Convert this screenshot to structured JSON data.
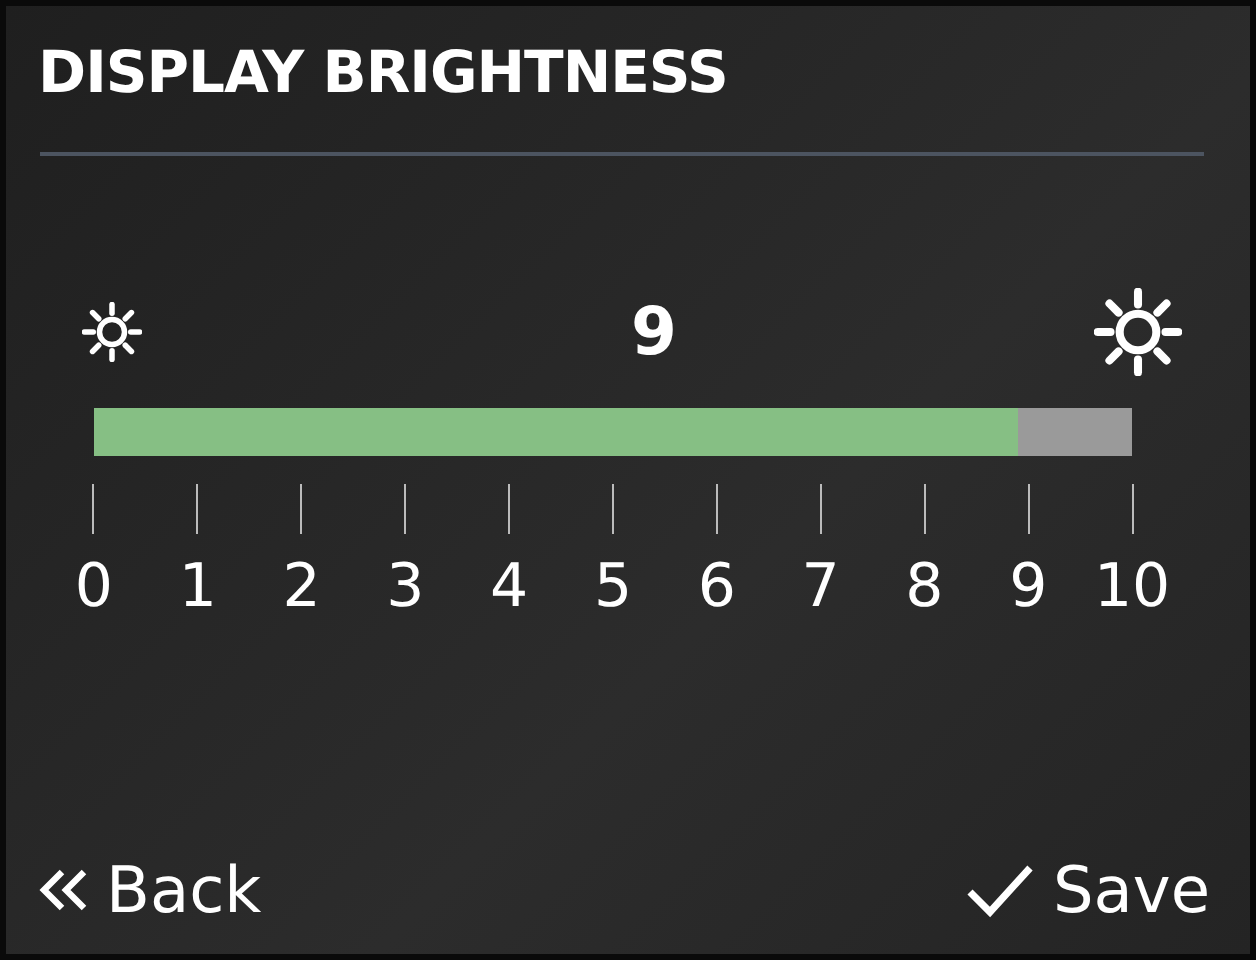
{
  "title": "DISPLAY BRIGHTNESS",
  "brightness": {
    "reading": "9",
    "level": 0.89
  },
  "scale": [
    "0",
    "1",
    "2",
    "3",
    "4",
    "5",
    "6",
    "7",
    "8",
    "9",
    "10"
  ],
  "buttons": [
    {
      "kind": "back",
      "label": "Back"
    },
    {
      "kind": "save",
      "label": "Save"
    }
  ]
}
